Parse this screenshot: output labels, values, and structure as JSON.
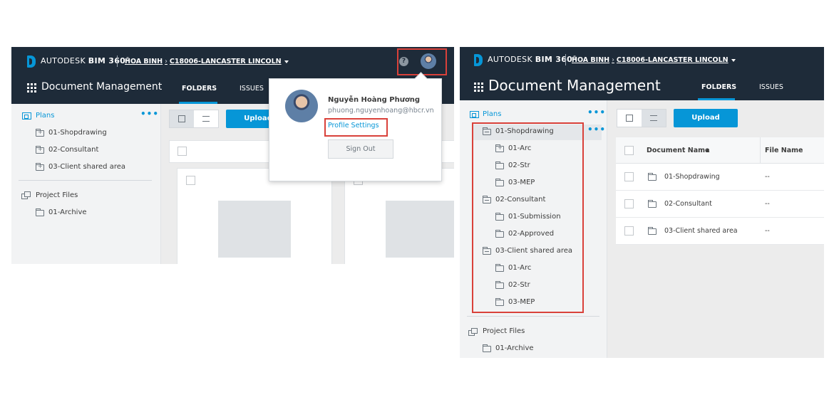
{
  "brand": {
    "company": "AUTODESK",
    "product": "BIM 360",
    "mark": "®"
  },
  "header": {
    "breadcrumb": {
      "account": "HOA BINH",
      "project": "C18006-LANCASTER LINCOLN"
    },
    "module_title": "Document Management",
    "tabs": [
      {
        "label": "FOLDERS"
      },
      {
        "label": "ISSUES"
      }
    ]
  },
  "profile_menu": {
    "name": "Nguyễn Hoàng Phương",
    "email": "phuong.nguyenhoang@hbcr.vn",
    "profile_settings": "Profile Settings",
    "sign_out": "Sign Out"
  },
  "help_glyph": "?",
  "sidebar": {
    "plans_label": "Plans",
    "more_glyph": "•••",
    "project_files_label": "Project Files",
    "left_plans_items": [
      {
        "label": "01-Shopdrawing"
      },
      {
        "label": "02-Consultant"
      },
      {
        "label": "03-Client shared area"
      }
    ],
    "project_files_items": [
      {
        "label": "01-Archive"
      }
    ],
    "tree": [
      {
        "label": "01-Shopdrawing",
        "children": [
          "01-Arc",
          "02-Str",
          "03-MEP"
        ]
      },
      {
        "label": "02-Consultant",
        "children": [
          "01-Submission",
          "02-Approved"
        ]
      },
      {
        "label": "03-Client shared area",
        "children": [
          "01-Arc",
          "02-Str",
          "03-MEP"
        ]
      }
    ]
  },
  "toolbar": {
    "upload_label": "Upload",
    "upload_partial": "Upload"
  },
  "table": {
    "columns": [
      "Document Name",
      "File Name"
    ],
    "sort_glyph": "▲",
    "rows": [
      {
        "name": "01-Shopdrawing",
        "file": "--"
      },
      {
        "name": "02-Consultant",
        "file": "--"
      },
      {
        "name": "03-Client shared area",
        "file": "--"
      }
    ]
  },
  "colors": {
    "topbar": "#1e2b39",
    "accent": "#0696d7",
    "highlight": "#d9413a",
    "sidebar": "#f2f3f4"
  }
}
